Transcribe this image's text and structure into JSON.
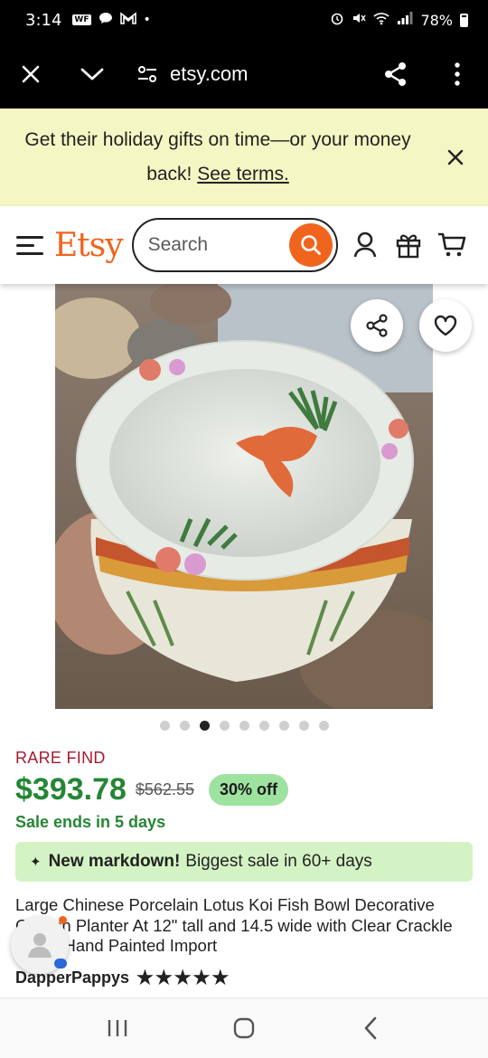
{
  "status_bar": {
    "time": "3:14",
    "notification_badge": "WF",
    "battery": "78%",
    "icons": [
      "wf-icon",
      "chat-bubble-icon",
      "gmail-icon",
      "dot-icon",
      "alarm-icon",
      "mute-icon",
      "wifi-icon",
      "signal-icon",
      "battery-icon"
    ]
  },
  "browser": {
    "url": "etsy.com",
    "icons": [
      "close-icon",
      "chevron-down-icon",
      "site-settings-icon",
      "share-icon",
      "more-icon"
    ]
  },
  "promo": {
    "text": "Get their holiday gifts on time—or your money back!",
    "link": "See terms."
  },
  "header": {
    "logo": "Etsy",
    "search_placeholder": "Search",
    "brand_color": "#f1641e",
    "icons": [
      "menu-icon",
      "search-icon",
      "account-icon",
      "gift-icon",
      "cart-icon"
    ]
  },
  "gallery": {
    "total_images": 9,
    "active_index": 3
  },
  "product": {
    "badge": "RARE FIND",
    "price": "$393.78",
    "original_price": "$562.55",
    "discount": "30% off",
    "sale_ends": "Sale ends in 5 days",
    "markdown_label": "New markdown!",
    "markdown_text": "Biggest sale in 60+ days",
    "title": "Large Chinese Porcelain Lotus Koi Fish Bowl Decorative Garden Planter At 12\" tall and 14.5 wide with Clear Crackle Glaze Hand Painted Import",
    "seller": "DapperPappys",
    "rating_stars": "★★★★★",
    "rating": 5
  },
  "colors": {
    "price_green": "#258635",
    "rare_red": "#a61a2e",
    "promo_bg": "#f4f7c3",
    "markdown_bg": "#d4f3c4",
    "discount_bg": "#9ee2a0"
  }
}
